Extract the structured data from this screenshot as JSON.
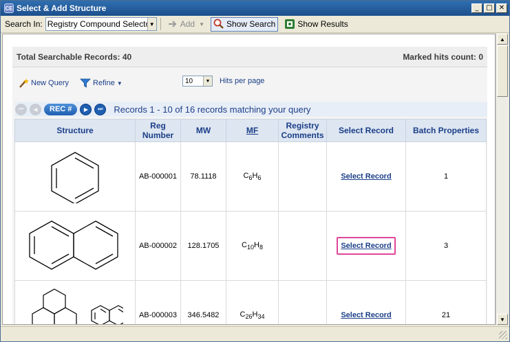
{
  "window": {
    "title": "Select & Add Structure",
    "app_icon_text": "CE",
    "controls": [
      "minimize",
      "maximize",
      "close"
    ]
  },
  "toolbar": {
    "search_in_label": "Search In:",
    "search_in_value": "Registry Compound Selector",
    "add_label": "Add",
    "show_search_label": "Show Search",
    "show_results_label": "Show Results"
  },
  "summary": {
    "total_label": "Total Searchable Records: 40",
    "marked_label": "Marked hits count: 0"
  },
  "actions": {
    "new_query_label": "New Query",
    "refine_label": "Refine",
    "hits_value": "10",
    "hits_label": "Hits per page"
  },
  "pager": {
    "rec_button_label": "REC #",
    "status_text": "Records 1 - 10 of 16 records matching your query"
  },
  "table": {
    "headers": {
      "structure": "Structure",
      "reg_number_1": "Reg",
      "reg_number_2": "Number",
      "mw": "MW",
      "mf": "MF",
      "comments_1": "Registry",
      "comments_2": "Comments",
      "select": "Select Record",
      "batch": "Batch Properties"
    },
    "rows": [
      {
        "reg": "AB-000001",
        "mw": "78.1118",
        "mf_parts": [
          "C",
          "6",
          "H",
          "6"
        ],
        "comments": "",
        "select_label": "Select Record",
        "batch": "1",
        "structure": "benzene"
      },
      {
        "reg": "AB-000002",
        "mw": "128.1705",
        "mf_parts": [
          "C",
          "10",
          "H",
          "8"
        ],
        "comments": "",
        "select_label": "Select Record",
        "batch": "3",
        "structure": "naphthalene",
        "highlighted": true
      },
      {
        "reg": "AB-000003",
        "mw": "346.5482",
        "mf_parts": [
          "C",
          "26",
          "H",
          "34"
        ],
        "comments": "",
        "select_label": "Select Record",
        "batch": "21",
        "structure": "polycyclic-mixture"
      }
    ]
  },
  "icons": {
    "add": "arrow-right-icon",
    "show_search": "search-magnifier-icon",
    "show_results": "results-grid-icon",
    "new_query": "magic-wand-icon",
    "refine": "funnel-icon"
  },
  "colors": {
    "title_bar": "#1d4f8c",
    "link_blue": "#1b3e88",
    "header_bg": "#dde6f1",
    "highlight_pink": "#e0449a"
  }
}
